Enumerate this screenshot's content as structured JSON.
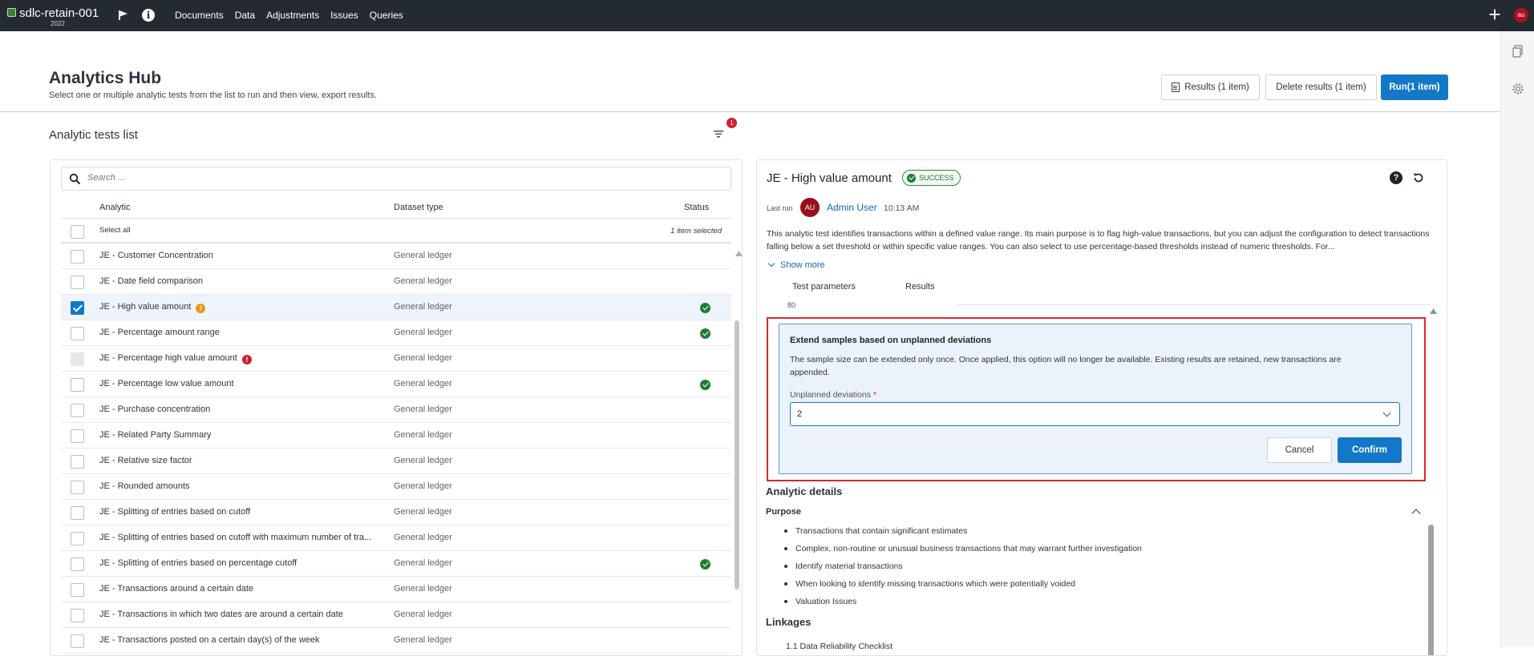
{
  "topbar": {
    "app_title": "sdlc-retain-001",
    "app_year": "2022",
    "nav": [
      "Documents",
      "Data",
      "Adjustments",
      "Issues",
      "Queries"
    ],
    "user_initials": "au"
  },
  "header": {
    "title": "Analytics Hub",
    "subtitle": "Select one or multiple analytic tests from the list to run and then view, export results.",
    "results_button": "Results (1 item)",
    "delete_button": "Delete results (1 item)",
    "run_button": "Run(1 item)"
  },
  "list": {
    "title": "Analytic tests list",
    "filter_count": "1",
    "search_placeholder": "Search ...",
    "columns": {
      "analytic": "Analytic",
      "dataset": "Dataset type",
      "status": "Status"
    },
    "select_all": "Select all",
    "selected_count": "1 item selected",
    "rows": [
      {
        "name": "JE - Customer Concentration",
        "dataset": "General ledger",
        "checked": false,
        "disabled": false,
        "status": "",
        "warn": ""
      },
      {
        "name": "JE - Date field comparison",
        "dataset": "General ledger",
        "checked": false,
        "disabled": false,
        "status": "",
        "warn": ""
      },
      {
        "name": "JE - High value amount",
        "dataset": "General ledger",
        "checked": true,
        "disabled": false,
        "status": "success",
        "warn": "orange"
      },
      {
        "name": "JE - Percentage amount range",
        "dataset": "General ledger",
        "checked": false,
        "disabled": false,
        "status": "success",
        "warn": ""
      },
      {
        "name": "JE - Percentage high value amount",
        "dataset": "General ledger",
        "checked": false,
        "disabled": true,
        "status": "",
        "warn": "red"
      },
      {
        "name": "JE - Percentage low value amount",
        "dataset": "General ledger",
        "checked": false,
        "disabled": false,
        "status": "success",
        "warn": ""
      },
      {
        "name": "JE - Purchase concentration",
        "dataset": "General ledger",
        "checked": false,
        "disabled": false,
        "status": "",
        "warn": ""
      },
      {
        "name": "JE - Related Party Summary",
        "dataset": "General ledger",
        "checked": false,
        "disabled": false,
        "status": "",
        "warn": ""
      },
      {
        "name": "JE - Relative size factor",
        "dataset": "General ledger",
        "checked": false,
        "disabled": false,
        "status": "",
        "warn": ""
      },
      {
        "name": "JE - Rounded amounts",
        "dataset": "General ledger",
        "checked": false,
        "disabled": false,
        "status": "",
        "warn": ""
      },
      {
        "name": "JE - Splitting of entries based on cutoff",
        "dataset": "General ledger",
        "checked": false,
        "disabled": false,
        "status": "",
        "warn": ""
      },
      {
        "name": "JE - Splitting of entries based on cutoff with maximum number of tra...",
        "dataset": "General ledger",
        "checked": false,
        "disabled": false,
        "status": "",
        "warn": ""
      },
      {
        "name": "JE - Splitting of entries based on percentage cutoff",
        "dataset": "General ledger",
        "checked": false,
        "disabled": false,
        "status": "success",
        "warn": ""
      },
      {
        "name": "JE - Transactions around a certain date",
        "dataset": "General ledger",
        "checked": false,
        "disabled": false,
        "status": "",
        "warn": ""
      },
      {
        "name": "JE - Transactions in which two dates are around a certain date",
        "dataset": "General ledger",
        "checked": false,
        "disabled": false,
        "status": "",
        "warn": ""
      },
      {
        "name": "JE - Transactions posted on a certain day(s) of the week",
        "dataset": "General ledger",
        "checked": false,
        "disabled": false,
        "status": "",
        "warn": ""
      }
    ]
  },
  "detail": {
    "title": "JE - High value amount",
    "status_badge": "SUCCESS",
    "last_run_label": "Last run",
    "last_run_initials": "AU",
    "last_run_user": "Admin User",
    "last_run_time": "10:13 AM",
    "description": "This analytic test identifies transactions within a defined value range. Its main purpose is to flag high-value transactions, but you can adjust the configuration to detect transactions falling below a set threshold or within specific value ranges. You can also select to use percentage-based thresholds instead of numeric thresholds. For...",
    "show_more": "Show more",
    "tabs": [
      "Test parameters",
      "Results"
    ],
    "cut_text": "80"
  },
  "extend": {
    "title": "Extend samples based on unplanned deviations",
    "text": "The sample size can be extended only once. Once applied, this option will no longer be available. Existing results are retained, new transactions are appended.",
    "field_label": "Unplanned deviations",
    "required_mark": "*",
    "value": "2",
    "cancel": "Cancel",
    "confirm": "Confirm"
  },
  "analytic_details": {
    "title": "Analytic details",
    "purpose_title": "Purpose",
    "purpose_items": [
      "Transactions that contain significant estimates",
      "Complex, non-routine or unusual business transactions that may warrant further investigation",
      "Identify material transactions",
      "When looking to identify missing transactions which were potentially voided",
      "Valuation Issues"
    ],
    "linkages_title": "Linkages",
    "linkage_item": "1.1 Data Reliability Checklist"
  },
  "colors": {
    "topbar": "#232a32",
    "primary": "#1478c8",
    "success": "#1e7d32",
    "danger": "#d0202e",
    "warning": "#e89a0c"
  }
}
